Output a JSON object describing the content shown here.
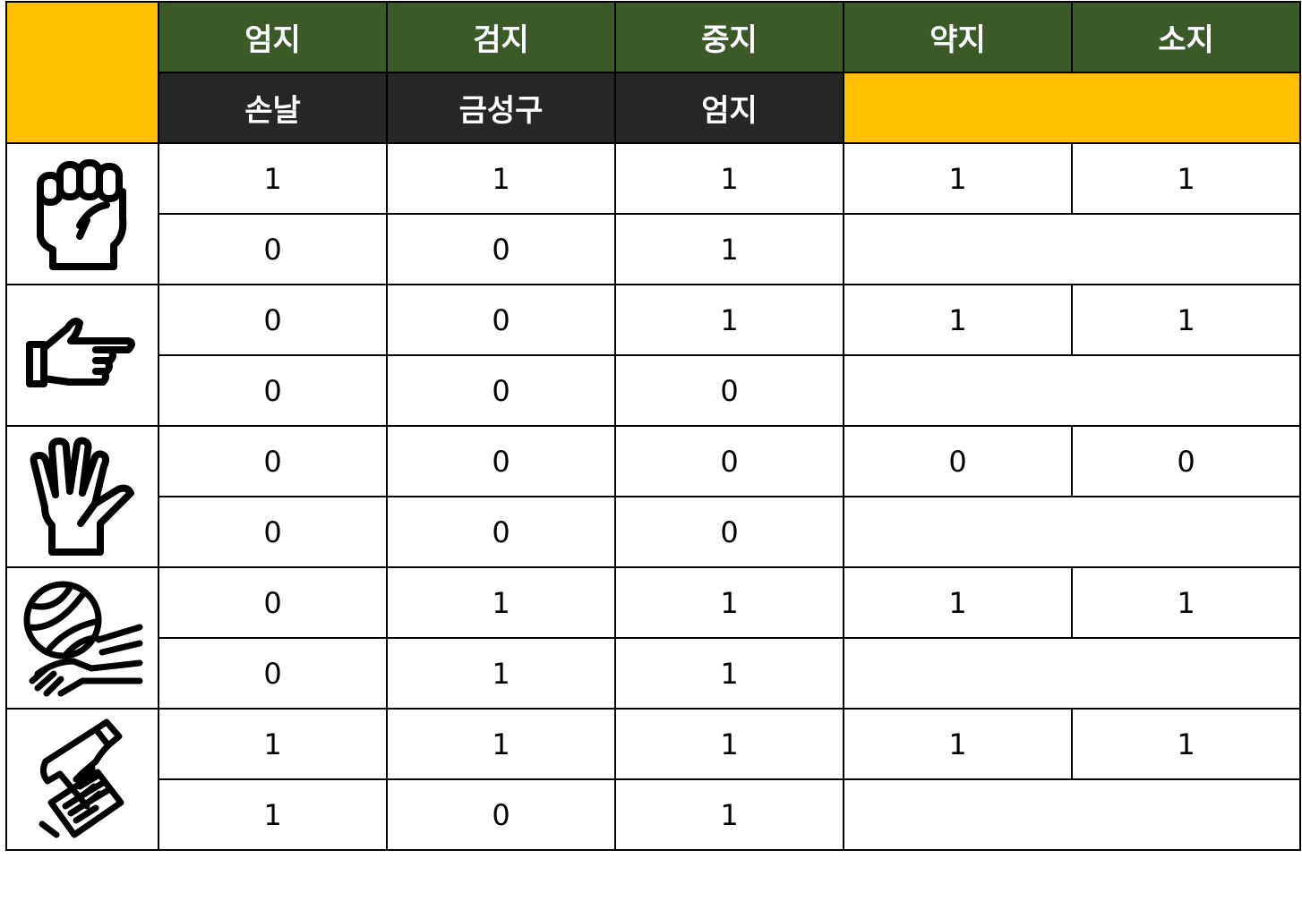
{
  "header": {
    "fingers": [
      "엄지",
      "검지",
      "중지",
      "약지",
      "소지"
    ],
    "sub": [
      "손날",
      "금성구",
      "엄지"
    ]
  },
  "rows": [
    {
      "icon": "fist-icon",
      "top": [
        "1",
        "1",
        "1",
        "1",
        "1"
      ],
      "bottom": [
        "0",
        "0",
        "1"
      ]
    },
    {
      "icon": "pointing-hand-icon",
      "top": [
        "0",
        "0",
        "1",
        "1",
        "1"
      ],
      "bottom": [
        "0",
        "0",
        "0"
      ]
    },
    {
      "icon": "open-hand-icon",
      "top": [
        "0",
        "0",
        "0",
        "0",
        "0"
      ],
      "bottom": [
        "0",
        "0",
        "0"
      ]
    },
    {
      "icon": "volleyball-hands-icon",
      "top": [
        "0",
        "1",
        "1",
        "1",
        "1"
      ],
      "bottom": [
        "0",
        "1",
        "1"
      ]
    },
    {
      "icon": "hand-grip-icon",
      "top": [
        "1",
        "1",
        "1",
        "1",
        "1"
      ],
      "bottom": [
        "1",
        "0",
        "1"
      ]
    }
  ],
  "colors": {
    "header_green": "#3B5A27",
    "header_dark": "#262626",
    "accent_yellow": "#FFC000"
  }
}
